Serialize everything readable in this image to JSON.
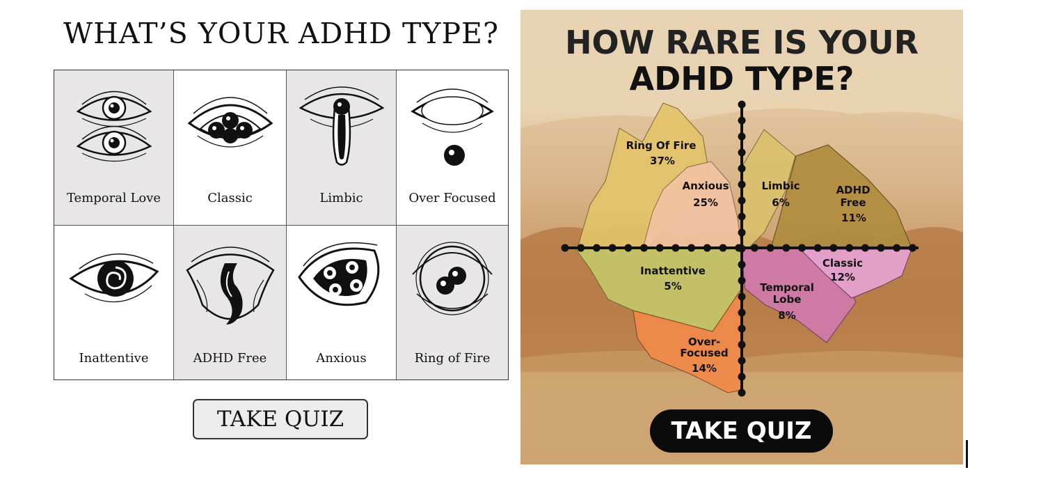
{
  "left_panel": {
    "title": "WHAT’S YOUR ADHD TYPE?",
    "types": [
      {
        "label": "Temporal Love",
        "icon": "double-eye-icon"
      },
      {
        "label": "Classic",
        "icon": "triple-pupil-eye-icon"
      },
      {
        "label": "Limbic",
        "icon": "teardrop-eye-icon"
      },
      {
        "label": "Over Focused",
        "icon": "empty-eye-icon"
      },
      {
        "label": "Inattentive",
        "icon": "swirl-eye-icon"
      },
      {
        "label": "ADHD Free",
        "icon": "melting-eye-icon"
      },
      {
        "label": "Anxious",
        "icon": "multi-pupil-eye-icon"
      },
      {
        "label": "Ring of Fire",
        "icon": "ring-eye-icon"
      }
    ],
    "quiz_button": "TAKE QUIZ"
  },
  "right_panel": {
    "title_line1": "HOW RARE IS YOUR",
    "title_line2": "ADHD TYPE?",
    "quiz_button": "TAKE QUIZ"
  },
  "chart_data": {
    "type": "area",
    "title": "HOW RARE IS YOUR ADHD TYPE?",
    "series": [
      {
        "name": "Ring Of Fire",
        "value": "37%",
        "color": "#e3c36a"
      },
      {
        "name": "Anxious",
        "value": "25%",
        "color": "#f2c3a2"
      },
      {
        "name": "Limbic",
        "value": "6%",
        "color": "#d9c06d"
      },
      {
        "name": "ADHD Free",
        "value": "11%",
        "color": "#b08c3e"
      },
      {
        "name": "Inattentive",
        "value": "5%",
        "color": "#c4c66a"
      },
      {
        "name": "Over-Focused",
        "value": "14%",
        "color": "#f08a4a"
      },
      {
        "name": "Temporal Lobe",
        "value": "8%",
        "color": "#cf79ad"
      },
      {
        "name": "Classic",
        "value": "12%",
        "color": "#e6a3d0"
      }
    ],
    "labels": {
      "ring_of_fire": [
        "Ring Of Fire",
        "37%"
      ],
      "anxious": [
        "Anxious",
        "25%"
      ],
      "limbic": [
        "Limbic",
        "6%"
      ],
      "adhd_free": [
        "ADHD",
        "Free",
        "11%"
      ],
      "inattentive": [
        "Inattentive",
        "5%"
      ],
      "over_focused": [
        "Over-",
        "Focused",
        "14%"
      ],
      "temporal_lobe": [
        "Temporal",
        "Lobe",
        "8%"
      ],
      "classic": [
        "Classic",
        "12%"
      ]
    }
  }
}
